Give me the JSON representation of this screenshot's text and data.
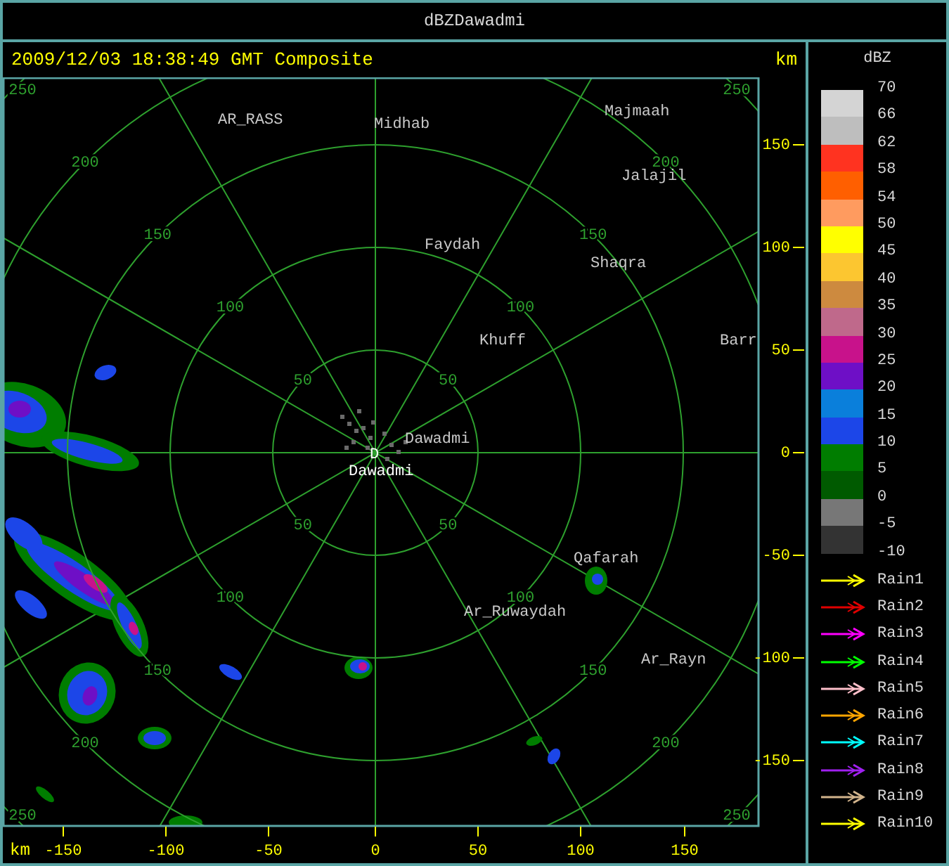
{
  "window": {
    "title": "dBZDawadmi"
  },
  "header": {
    "timestamp": "2009/12/03 18:38:49 GMT Composite",
    "unit": "km"
  },
  "map": {
    "rings": [
      {
        "labels": [
          "50",
          "50",
          "50",
          "50"
        ]
      },
      {
        "labels": [
          "100",
          "100",
          "100",
          "100"
        ]
      },
      {
        "labels": [
          "150",
          "150",
          "150",
          "150"
        ]
      },
      {
        "labels": [
          "200",
          "200",
          "200",
          "200"
        ]
      },
      {
        "labels": [
          "250",
          "250",
          "250",
          "250"
        ]
      }
    ],
    "places": [
      {
        "name": "AR_RASS",
        "kind": "town"
      },
      {
        "name": "Midhab",
        "kind": "town"
      },
      {
        "name": "Majmaah",
        "kind": "town"
      },
      {
        "name": "Jalajil",
        "kind": "town"
      },
      {
        "name": "Faydah",
        "kind": "town"
      },
      {
        "name": "Shaqra",
        "kind": "town"
      },
      {
        "name": "Khuff",
        "kind": "town"
      },
      {
        "name": "Barr",
        "kind": "town"
      },
      {
        "name": "Dawadmi",
        "kind": "town"
      },
      {
        "name": "D",
        "kind": "radar_site"
      },
      {
        "name": "Dawadmi",
        "kind": "radar_name"
      },
      {
        "name": "Qafarah",
        "kind": "town"
      },
      {
        "name": "Ar_Ruwaydah",
        "kind": "town"
      },
      {
        "name": "Ar_Rayn",
        "kind": "town"
      }
    ]
  },
  "y_axis": {
    "ticks": [
      "150",
      "100",
      "50",
      "0",
      "-50",
      "-100",
      "-150"
    ]
  },
  "x_axis": {
    "unit": "km",
    "ticks": [
      "-150",
      "-100",
      "-50",
      "0",
      "50",
      "100",
      "150"
    ]
  },
  "legend": {
    "title": "dBZ",
    "scale": [
      {
        "color": "#d4d4d4"
      },
      {
        "color": "#bebebe"
      },
      {
        "color": "#ff3320"
      },
      {
        "color": "#ff5f00"
      },
      {
        "color": "#ff9b5f"
      },
      {
        "color": "#ffff00"
      },
      {
        "color": "#fcc630"
      },
      {
        "color": "#cd8a3f"
      },
      {
        "color": "#bf698b"
      },
      {
        "color": "#c8128b"
      },
      {
        "color": "#6e0fc6"
      },
      {
        "color": "#0a7fdb"
      },
      {
        "color": "#1c46e8"
      },
      {
        "color": "#007d00"
      },
      {
        "color": "#005a00"
      },
      {
        "color": "#777777"
      },
      {
        "color": "#333333"
      }
    ],
    "scale_labels": [
      "70",
      "66",
      "62",
      "58",
      "54",
      "50",
      "45",
      "40",
      "35",
      "30",
      "25",
      "20",
      "15",
      "10",
      "5",
      "0",
      "-5",
      "-10"
    ],
    "tracks": [
      {
        "label": "Rain1",
        "color": "#ffff00"
      },
      {
        "label": "Rain2",
        "color": "#e00000"
      },
      {
        "label": "Rain3",
        "color": "#ff00ff"
      },
      {
        "label": "Rain4",
        "color": "#00ff00"
      },
      {
        "label": "Rain5",
        "color": "#ffc0cb"
      },
      {
        "label": "Rain6",
        "color": "#ffa500"
      },
      {
        "label": "Rain7",
        "color": "#00ffff"
      },
      {
        "label": "Rain8",
        "color": "#a020f0"
      },
      {
        "label": "Rain9",
        "color": "#d2b48c"
      },
      {
        "label": "Rain10",
        "color": "#ffff00"
      }
    ]
  }
}
